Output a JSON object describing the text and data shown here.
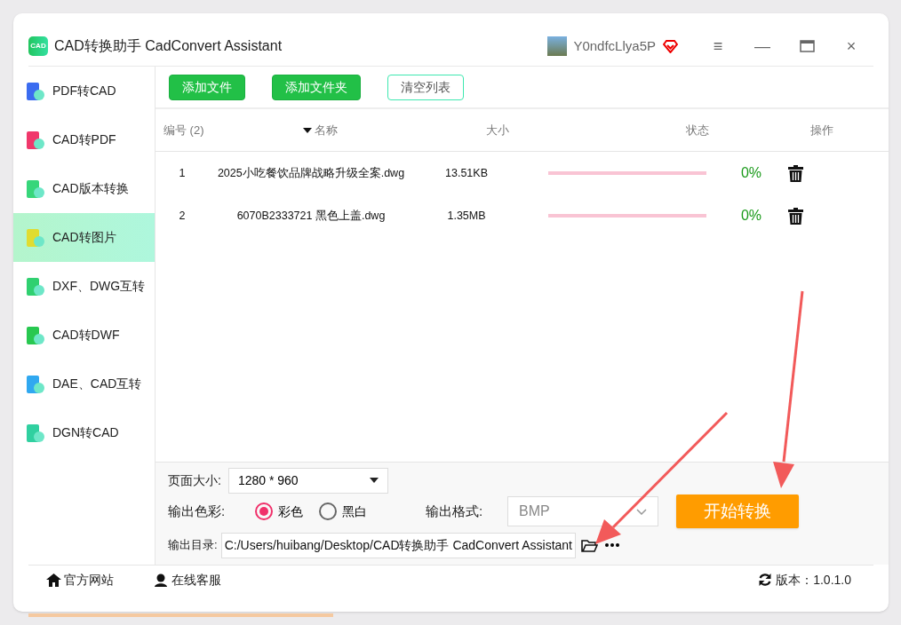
{
  "window": {
    "title": "CAD转换助手 CadConvert Assistant",
    "logo_text": "CAD",
    "user": "Y0ndfcLlya5P",
    "controls": [
      "≡",
      "—",
      "×"
    ]
  },
  "sidebar": {
    "items": [
      {
        "label": "PDF转CAD",
        "color": "#3b6cf0",
        "selected": false
      },
      {
        "label": "CAD转PDF",
        "color": "#f0386b",
        "selected": false
      },
      {
        "label": "CAD版本转换",
        "color": "#37d67a",
        "selected": false
      },
      {
        "label": "CAD转图片",
        "color": "#e0dc30",
        "selected": true
      },
      {
        "label": "DXF、DWG互转",
        "color": "#30d070",
        "selected": false
      },
      {
        "label": "CAD转DWF",
        "color": "#28c850",
        "selected": false
      },
      {
        "label": "DAE、CAD互转",
        "color": "#30a8f0",
        "selected": false
      },
      {
        "label": "DGN转CAD",
        "color": "#30d0a0",
        "selected": false
      }
    ]
  },
  "toolbar": {
    "buttons": [
      {
        "label": "添加文件",
        "kind": "primary"
      },
      {
        "label": "添加文件夹",
        "kind": "primary"
      },
      {
        "label": "清空列表",
        "kind": "outline"
      }
    ]
  },
  "table": {
    "columns": [
      "编号 (2)",
      "名称",
      "大小",
      "状态",
      "操作"
    ],
    "rows": [
      {
        "index": "1",
        "name": "2025小吃餐饮品牌战略升级全案.dwg",
        "size": "13.51KB",
        "level": 0,
        "percent": "0%"
      },
      {
        "index": "2",
        "name": "6070B2333721 黑色上盖.dwg",
        "size": "1.35MB",
        "level": 0,
        "percent": "0%"
      }
    ]
  },
  "settings": {
    "page_size_label": "页面大小:",
    "page_size": "1280 * 960",
    "color_label": "输出色彩:",
    "color_options": [
      {
        "label": "彩色",
        "selected": true
      },
      {
        "label": "黑白",
        "selected": false
      }
    ],
    "format_label": "输出格式:",
    "format": "BMP",
    "start_button": "开始转换",
    "output_dir_label": "输出目录:",
    "output_dir": "C:/Users/huibang/Desktop/CAD转换助手 CadConvert Assistant"
  },
  "status_bar": {
    "website": "官方网站",
    "support": "在线客服",
    "version": "版本：1.0.1.0"
  }
}
